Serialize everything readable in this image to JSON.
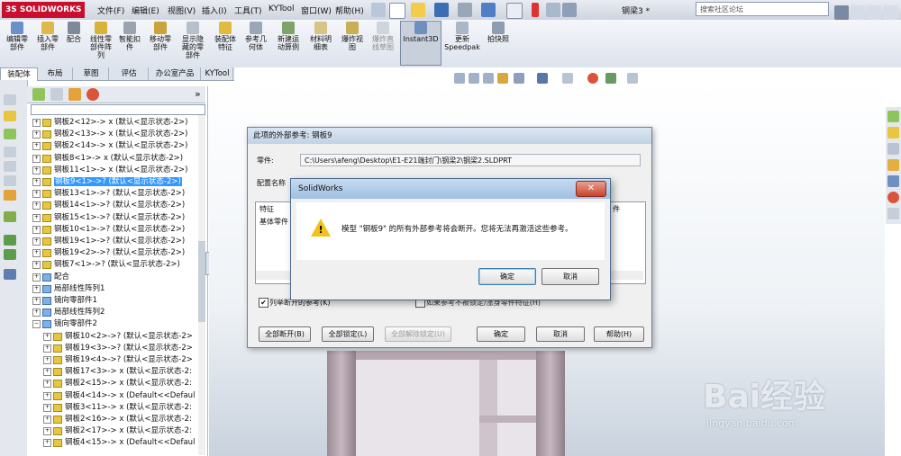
{
  "app": {
    "logo_text": "3S SOLIDWORKS",
    "doc_title": "钢梁3 *",
    "search_placeholder": "搜索社区论坛"
  },
  "menu": [
    "文件(F)",
    "编辑(E)",
    "视图(V)",
    "插入(I)",
    "工具(T)",
    "KYTool",
    "窗口(W)",
    "帮助(H)"
  ],
  "commands": [
    {
      "label": "编辑零\n部件"
    },
    {
      "label": "插入零\n部件"
    },
    {
      "label": "配合"
    },
    {
      "label": "线性零\n部件阵\n列"
    },
    {
      "label": "智能扣\n件"
    },
    {
      "label": "移动零\n部件"
    },
    {
      "label": "显示隐\n藏的零\n部件"
    },
    {
      "label": "装配体\n特征"
    },
    {
      "label": "参考几\n何体"
    },
    {
      "label": "新建运\n动算例"
    },
    {
      "label": "材料明\n细表"
    },
    {
      "label": "爆炸视\n图"
    },
    {
      "label": "爆炸直\n线草图"
    },
    {
      "label": "Instant3D"
    },
    {
      "label": "更新\nSpeedpak"
    },
    {
      "label": "拍快照"
    }
  ],
  "cmd_tabs": [
    "装配体",
    "布局",
    "草图",
    "评估",
    "办公室产品",
    "KYTool"
  ],
  "tree": [
    {
      "label": "钢板2<12>-> x (默认<显示状态-2>)",
      "indent": 0
    },
    {
      "label": "钢板2<13>-> x (默认<显示状态-2>)",
      "indent": 0
    },
    {
      "label": "钢板2<14>-> x (默认<显示状态-2>)",
      "indent": 0
    },
    {
      "label": "钢板8<1>-> x (默认<显示状态-2>)",
      "indent": 0
    },
    {
      "label": "钢板11<1>-> x (默认<显示状态-2>)",
      "indent": 0
    },
    {
      "label": "钢板9<1>->? (默认<显示状态-2>)",
      "indent": 0,
      "selected": true
    },
    {
      "label": "钢板13<1>->? (默认<显示状态-2>)",
      "indent": 0
    },
    {
      "label": "钢板14<1>->? (默认<显示状态-2>)",
      "indent": 0
    },
    {
      "label": "钢板15<1>->? (默认<显示状态-2>)",
      "indent": 0
    },
    {
      "label": "钢板10<1>->? (默认<显示状态-2>)",
      "indent": 0
    },
    {
      "label": "钢板19<1>->? (默认<显示状态-2>)",
      "indent": 0
    },
    {
      "label": "钢板19<2>->? (默认<显示状态-2>)",
      "indent": 0
    },
    {
      "label": "钢板7<1>->? (默认<显示状态-2>)",
      "indent": 0
    },
    {
      "label": "配合",
      "indent": 0,
      "group": true
    },
    {
      "label": "局部线性阵列1",
      "indent": 0,
      "group": true
    },
    {
      "label": "镜向零部件1",
      "indent": 0,
      "group": true
    },
    {
      "label": "局部线性阵列2",
      "indent": 0,
      "group": true
    },
    {
      "label": "镜向零部件2",
      "indent": 0,
      "group": true,
      "expanded": true
    },
    {
      "label": "钢板10<2>->? (默认<显示状态-2>",
      "indent": 1
    },
    {
      "label": "钢板19<3>->? (默认<显示状态-2>",
      "indent": 1
    },
    {
      "label": "钢板19<4>->? (默认<显示状态-2>",
      "indent": 1
    },
    {
      "label": "钢板17<3>-> x (默认<显示状态-2:",
      "indent": 1
    },
    {
      "label": "钢板2<15>-> x (默认<显示状态-2:",
      "indent": 1
    },
    {
      "label": "钢板4<14>-> x (Default<<Defaul",
      "indent": 1
    },
    {
      "label": "钢板3<11>-> x (默认<显示状态-2:",
      "indent": 1
    },
    {
      "label": "钢板2<16>-> x (默认<显示状态-2:",
      "indent": 1
    },
    {
      "label": "钢板2<17>-> x (默认<显示状态-2:",
      "indent": 1
    },
    {
      "label": "钢板4<15>-> x (Default<<Defaul",
      "indent": 1
    }
  ],
  "dialog_refs": {
    "title": "此项的外部参考: 钢板9",
    "part_label": "零件:",
    "part_path": "C:\\Users\\afeng\\Desktop\\E1-E21端封门\\钢梁2\\钢梁2.SLDPRT",
    "config_label": "配置名称",
    "col_feature": "特征",
    "col_part": "件",
    "base_part": "基体零件",
    "checkbox_label": "列举断开的参考(K)",
    "checkbox2_label": "如果参考不被锁定/涨身零件特征(H)",
    "btn_break_all": "全部断开(B)",
    "btn_lock_all": "全部锁定(L)",
    "btn_unlock_all": "全部解除锁定(U)",
    "btn_ok": "确定",
    "btn_cancel": "取消",
    "btn_help": "帮助(H)"
  },
  "dialog_warn": {
    "title": "SolidWorks",
    "message": "模型 \"钢板9\" 的所有外部参考将会断开。您将无法再激活这些参考。",
    "btn_ok": "确定",
    "btn_cancel": "取消",
    "close": "✕"
  },
  "watermark": {
    "brand": "Bai经验",
    "url": "jingyan.baidu.com"
  },
  "colors": {
    "selection": "#3399ff",
    "logo_red": "#c8102e",
    "warning_yellow": "#f2c21a"
  }
}
